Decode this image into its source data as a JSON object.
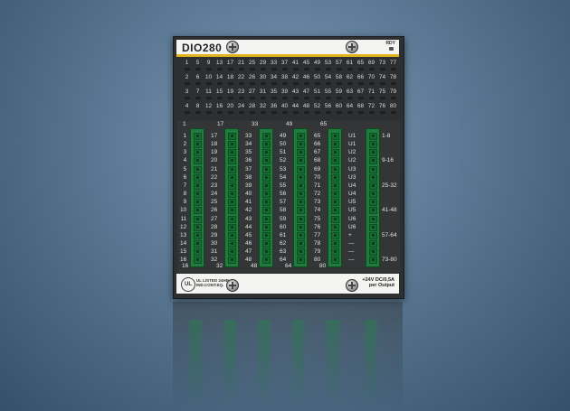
{
  "module": {
    "brand": "DIO280",
    "rdy_label": "RDY",
    "led_rows": [
      [
        "1",
        "5",
        "9",
        "13",
        "17",
        "21",
        "25",
        "29",
        "33",
        "37",
        "41",
        "45",
        "49",
        "53",
        "57",
        "61",
        "65",
        "69",
        "73",
        "77"
      ],
      [
        "2",
        "6",
        "10",
        "14",
        "18",
        "22",
        "26",
        "30",
        "34",
        "38",
        "42",
        "46",
        "50",
        "54",
        "58",
        "62",
        "66",
        "70",
        "74",
        "78"
      ],
      [
        "3",
        "7",
        "11",
        "15",
        "19",
        "23",
        "27",
        "31",
        "35",
        "39",
        "43",
        "47",
        "51",
        "55",
        "59",
        "63",
        "67",
        "71",
        "75",
        "79"
      ],
      [
        "4",
        "8",
        "12",
        "16",
        "20",
        "24",
        "28",
        "32",
        "36",
        "40",
        "44",
        "48",
        "52",
        "56",
        "60",
        "64",
        "68",
        "72",
        "76",
        "80"
      ]
    ],
    "connectors": [
      {
        "top": "1",
        "bottom": "16",
        "labels": [
          "1",
          "2",
          "3",
          "4",
          "5",
          "6",
          "7",
          "8",
          "9",
          "10",
          "11",
          "12",
          "13",
          "14",
          "15",
          "16"
        ]
      },
      {
        "top": "17",
        "bottom": "32",
        "labels": [
          "17",
          "18",
          "19",
          "20",
          "21",
          "22",
          "23",
          "24",
          "25",
          "26",
          "27",
          "28",
          "29",
          "30",
          "31",
          "32"
        ]
      },
      {
        "top": "33",
        "bottom": "48",
        "labels": [
          "33",
          "34",
          "35",
          "36",
          "37",
          "38",
          "39",
          "40",
          "41",
          "42",
          "43",
          "44",
          "45",
          "46",
          "47",
          "48"
        ]
      },
      {
        "top": "49",
        "bottom": "64",
        "labels": [
          "49",
          "50",
          "51",
          "52",
          "53",
          "54",
          "55",
          "56",
          "57",
          "58",
          "59",
          "60",
          "61",
          "62",
          "63",
          "64"
        ]
      },
      {
        "top": "65",
        "bottom": "80",
        "labels": [
          "65",
          "66",
          "67",
          "68",
          "69",
          "70",
          "71",
          "72",
          "73",
          "74",
          "75",
          "76",
          "77",
          "78",
          "79",
          "80"
        ]
      }
    ],
    "power_labels": [
      "U1",
      "U1",
      "U2",
      "U2",
      "U3",
      "U3",
      "U4",
      "U4",
      "U5",
      "U5",
      "U6",
      "U6",
      "+",
      "—",
      "—",
      "—"
    ],
    "group_labels": [
      "1-8",
      "",
      "",
      "9-16",
      "",
      "",
      "25-32",
      "",
      "",
      "41-48",
      "",
      "",
      "57-64",
      "",
      "",
      "73-80"
    ],
    "ul_text": [
      "UL LISTED 24HB",
      "IND.CONT.EQ."
    ],
    "rating": [
      "+24V DC/0,5A",
      "per Output"
    ]
  }
}
